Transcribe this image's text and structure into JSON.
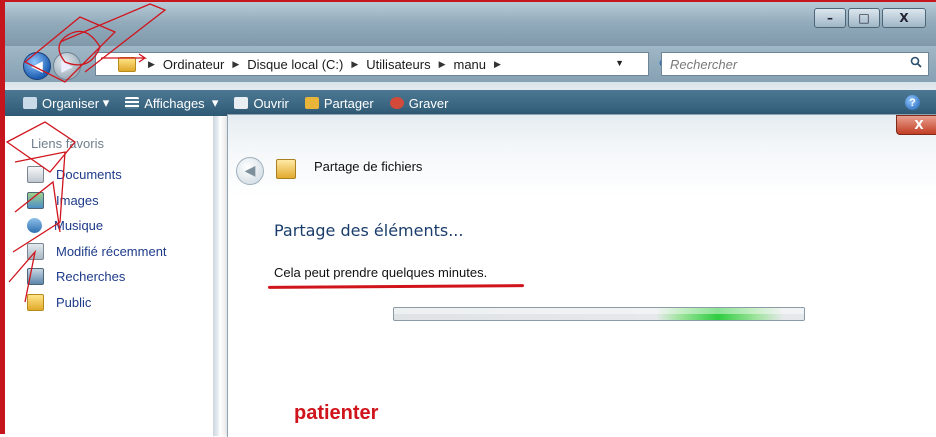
{
  "window": {
    "caption_minimize": "–",
    "caption_maximize": "□",
    "caption_close": "X"
  },
  "addressbar": {
    "crumbs": [
      "Ordinateur",
      "Disque local (C:)",
      "Utilisateurs",
      "manu"
    ],
    "search_placeholder": "Rechercher"
  },
  "toolbar": {
    "items": [
      "Organiser",
      "Affichages",
      "Ouvrir",
      "Partager",
      "Graver"
    ],
    "help": "?"
  },
  "sidebar": {
    "title": "Liens favoris",
    "items": [
      "Documents",
      "Images",
      "Musique",
      "Modifié récemment",
      "Recherches",
      "Public"
    ]
  },
  "dialog": {
    "title": "Partage de fichiers",
    "close": "X",
    "heading": "Partage des éléments...",
    "info": "Cela peut prendre quelques minutes.",
    "progress": 0.78
  },
  "annotation": {
    "text": "patienter",
    "color": "#d0141c"
  },
  "icons": {
    "back": "back-arrow-icon",
    "forward": "forward-arrow-icon",
    "folder": "folder-icon",
    "search": "search-icon",
    "refresh": "refresh-icon",
    "help": "help-icon"
  }
}
